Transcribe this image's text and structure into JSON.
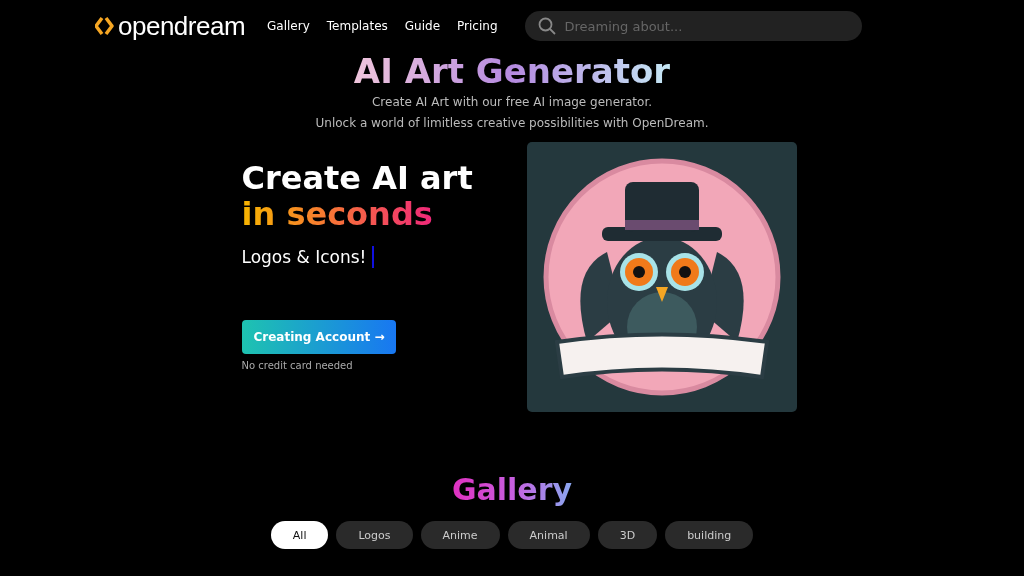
{
  "header": {
    "logo": "opendream",
    "nav": [
      {
        "label": "Gallery"
      },
      {
        "label": "Templates"
      },
      {
        "label": "Guide"
      },
      {
        "label": "Pricing"
      }
    ],
    "search": {
      "placeholder": "Dreaming about..."
    }
  },
  "hero": {
    "title": "AI Art Generator",
    "subtitle_lines": [
      "Create AI Art with our free AI image generator.",
      "Unlock a world of limitless creative possibilities with OpenDream."
    ],
    "headline": "Create AI art",
    "headline_accent": "in seconds",
    "typing_text": "Logos & Icons!",
    "cta": "Creating Account →",
    "cta_note": "No credit card needed"
  },
  "gallery": {
    "title": "Gallery",
    "filters": [
      {
        "label": "All",
        "selected": true
      },
      {
        "label": "Logos",
        "selected": false
      },
      {
        "label": "Anime",
        "selected": false
      },
      {
        "label": "Animal",
        "selected": false
      },
      {
        "label": "3D",
        "selected": false
      },
      {
        "label": "building",
        "selected": false
      }
    ]
  }
}
